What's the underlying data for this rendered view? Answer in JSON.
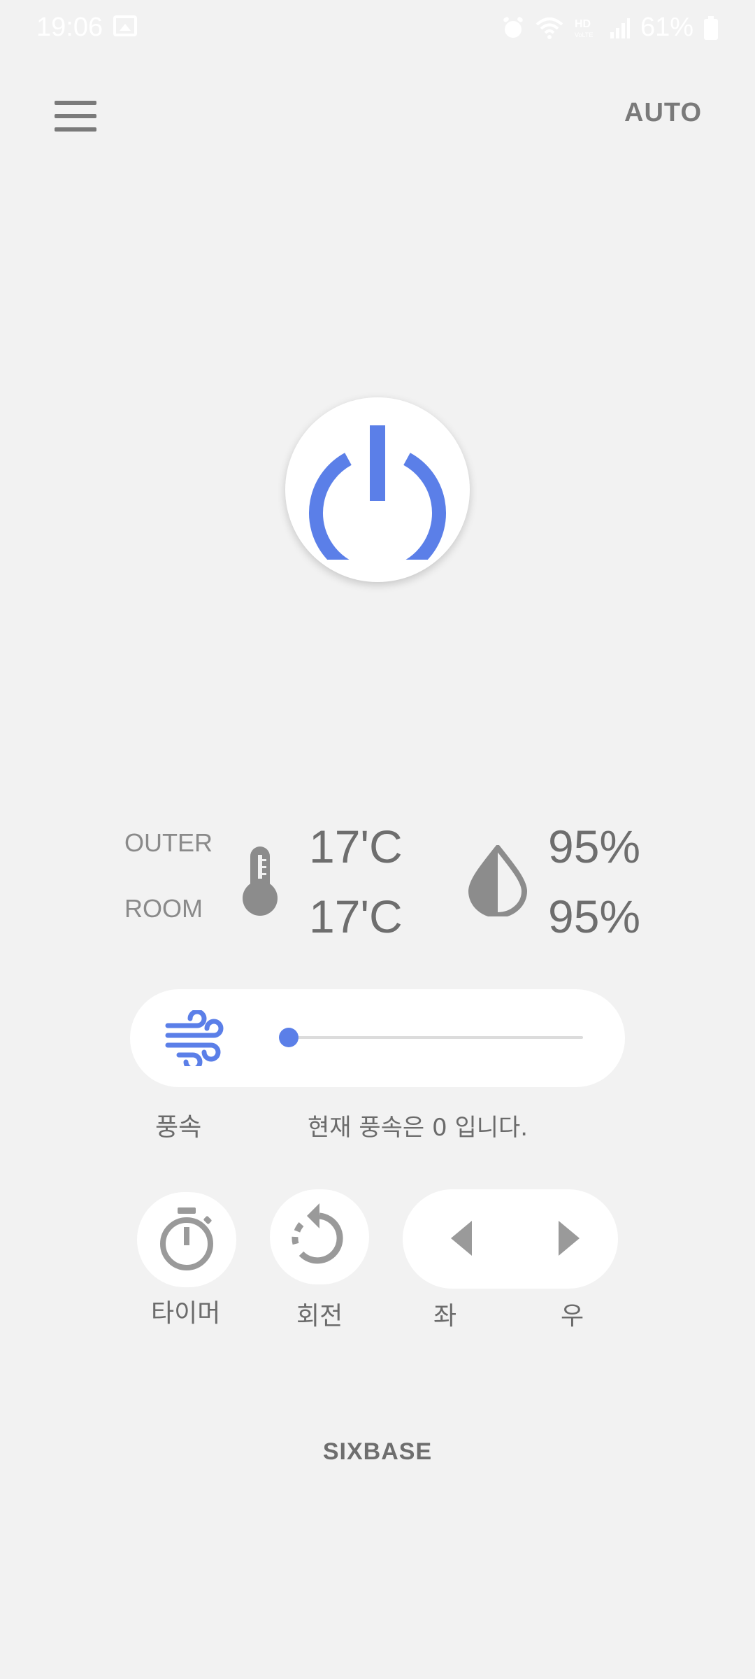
{
  "status_bar": {
    "time": "19:06",
    "battery_percent": "61%",
    "icons": [
      "gallery-icon",
      "alarm-icon",
      "wifi-icon",
      "hd-voice-icon",
      "signal-icon",
      "battery-icon"
    ]
  },
  "header": {
    "menu_icon": "hamburger-menu-icon",
    "mode_label": "AUTO"
  },
  "power": {
    "icon": "power-icon",
    "accent_color": "#5b7fe8"
  },
  "readings": {
    "outer_label": "OUTER",
    "room_label": "ROOM",
    "outer_temp": "17'C",
    "room_temp": "17'C",
    "outer_humidity": "95%",
    "room_humidity": "95%",
    "temp_icon": "thermometer-icon",
    "humidity_icon": "water-drop-icon"
  },
  "wind": {
    "icon": "wind-icon",
    "speed_value": 0,
    "label": "풍속",
    "status_text": "현재 풍속은 0 입니다."
  },
  "controls": {
    "timer_label": "타이머",
    "timer_icon": "timer-icon",
    "rotate_label": "회전",
    "rotate_icon": "rotate-icon",
    "left_label": "좌",
    "left_icon": "triangle-left-icon",
    "right_label": "우",
    "right_icon": "triangle-right-icon"
  },
  "footer": {
    "brand": "SIXBASE"
  }
}
